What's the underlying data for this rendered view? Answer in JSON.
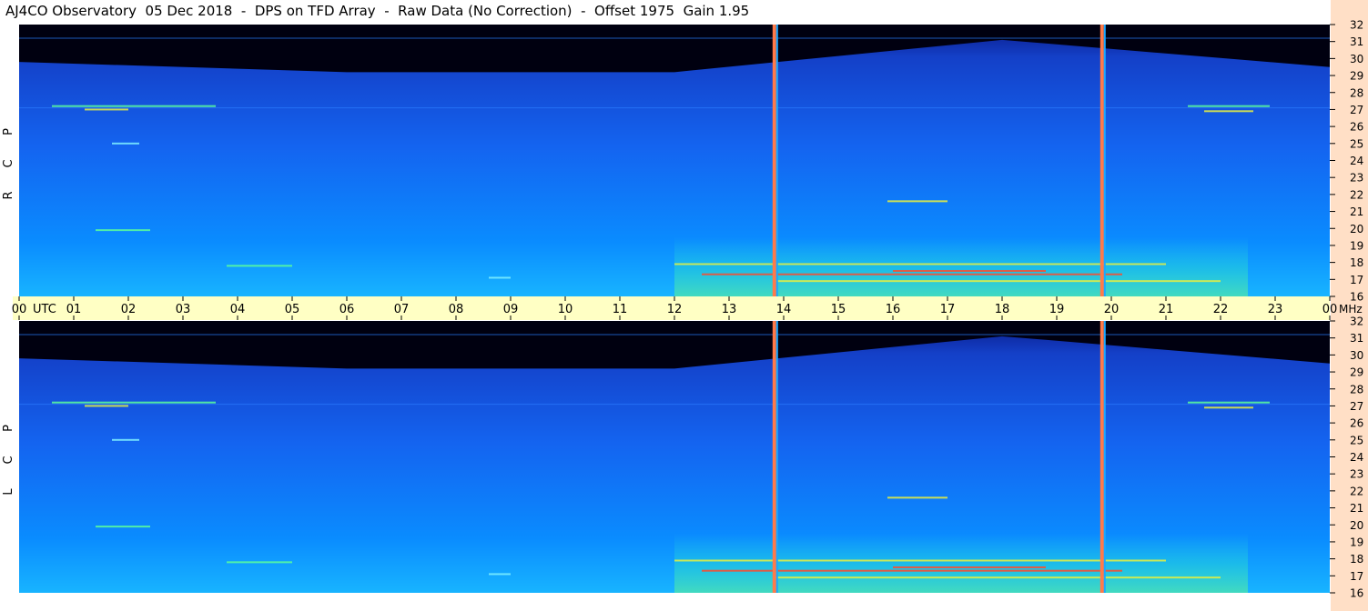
{
  "title": "AJ4CO Observatory  05 Dec 2018  -  DPS on TFD Array  -  Raw Data (No Correction)  -  Offset 1975  Gain 1.95",
  "colors": {
    "background": "#ffffff",
    "time_axis_band": "#ffffc4",
    "freq_axis_band": "#ffdfc6",
    "sky_dark": "#000010",
    "spectrum_blue": "#1a5cff",
    "spectrum_cyan": "#12b4ff",
    "signal_green": "#5cff9a",
    "signal_yellow": "#e8f040",
    "signal_red": "#ff4a2a"
  },
  "chart_data": {
    "type": "heatmap",
    "title": "AJ4CO Observatory  05 Dec 2018  -  DPS on TFD Array  -  Raw Data (No Correction)  -  Offset 1975  Gain 1.95",
    "panels": [
      {
        "name": "RCP",
        "label_chars": [
          "P",
          "C",
          "R"
        ]
      },
      {
        "name": "LCP",
        "label_chars": [
          "P",
          "C",
          "L"
        ]
      }
    ],
    "x_axis": {
      "unit_label": "UTC",
      "range_hours": [
        0,
        24
      ],
      "tick_labels": [
        "00",
        "01",
        "02",
        "03",
        "04",
        "05",
        "06",
        "07",
        "08",
        "09",
        "10",
        "11",
        "12",
        "13",
        "14",
        "15",
        "16",
        "17",
        "18",
        "19",
        "20",
        "21",
        "22",
        "23",
        "00"
      ]
    },
    "y_axis": {
      "unit_label": "MHz",
      "range_mhz": [
        16,
        32
      ],
      "tick_labels": [
        "32",
        "31",
        "30",
        "29",
        "28",
        "27",
        "26",
        "25",
        "24",
        "23",
        "22",
        "21",
        "20",
        "19",
        "18",
        "17",
        "16"
      ]
    },
    "events": {
      "vertical_interference_lines_utc": [
        13.83,
        19.83
      ],
      "horizontal_lines_mhz": [
        31.2,
        27.1
      ],
      "dark_ceiling_mhz": [
        [
          0,
          29.8
        ],
        [
          6,
          29.2
        ],
        [
          12,
          29.2
        ],
        [
          18,
          31.1
        ],
        [
          24,
          29.5
        ]
      ],
      "bright_band_hours": [
        12,
        22.5
      ],
      "bright_band_mhz": [
        16,
        19.5
      ],
      "streaks": [
        {
          "t0": 0.6,
          "t1": 3.6,
          "f": 27.2,
          "intensity": "green"
        },
        {
          "t0": 1.2,
          "t1": 2.0,
          "f": 27.0,
          "intensity": "yellow"
        },
        {
          "t0": 21.4,
          "t1": 22.9,
          "f": 27.2,
          "intensity": "green"
        },
        {
          "t0": 21.7,
          "t1": 22.6,
          "f": 26.9,
          "intensity": "yellow"
        },
        {
          "t0": 1.7,
          "t1": 2.2,
          "f": 25.0,
          "intensity": "cyan"
        },
        {
          "t0": 1.4,
          "t1": 2.4,
          "f": 19.9,
          "intensity": "green"
        },
        {
          "t0": 15.9,
          "t1": 17.0,
          "f": 21.6,
          "intensity": "yellow"
        },
        {
          "t0": 12.0,
          "t1": 21.0,
          "f": 17.9,
          "intensity": "yellow"
        },
        {
          "t0": 12.5,
          "t1": 20.2,
          "f": 17.3,
          "intensity": "red"
        },
        {
          "t0": 13.8,
          "t1": 22.0,
          "f": 16.9,
          "intensity": "yellow"
        },
        {
          "t0": 16.0,
          "t1": 18.8,
          "f": 17.5,
          "intensity": "red"
        },
        {
          "t0": 3.8,
          "t1": 5.0,
          "f": 17.8,
          "intensity": "green"
        },
        {
          "t0": 8.6,
          "t1": 9.0,
          "f": 17.1,
          "intensity": "cyan"
        }
      ]
    }
  }
}
